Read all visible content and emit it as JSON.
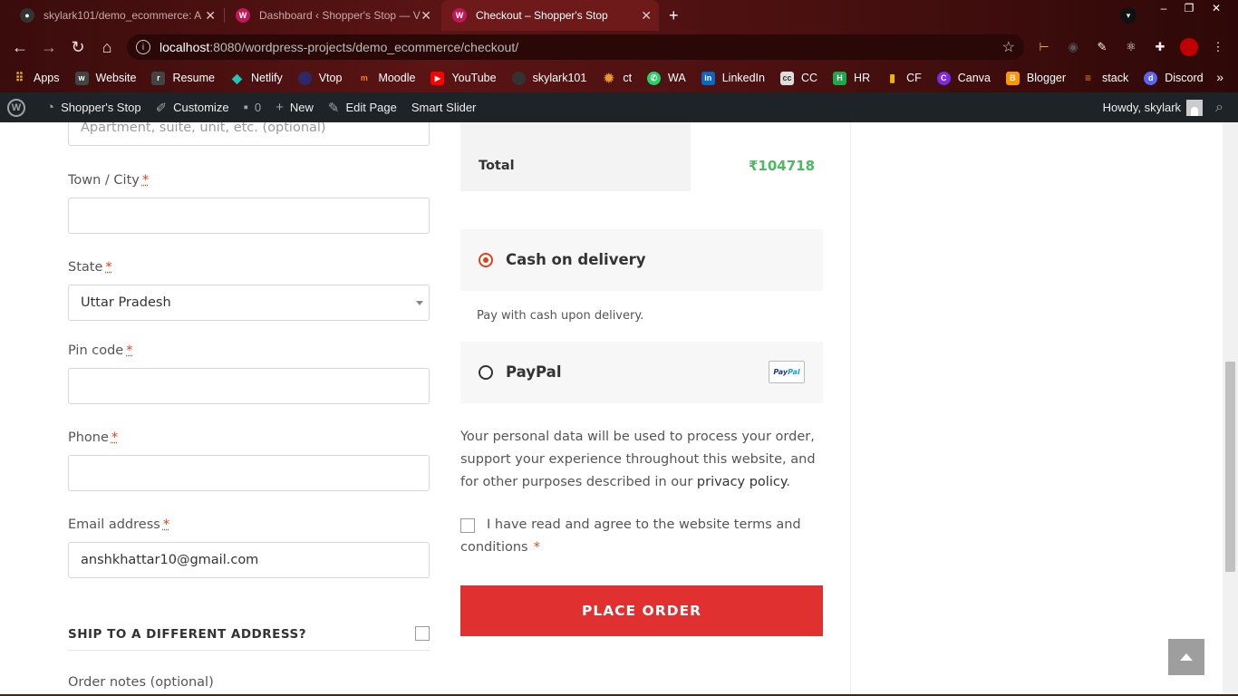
{
  "browser": {
    "tabs": [
      {
        "title": "skylark101/demo_ecommerce: A",
        "icon": "github-icon"
      },
      {
        "title": "Dashboard ‹ Shopper's Stop — V",
        "icon": "wordpress-icon"
      },
      {
        "title": "Checkout – Shopper's Stop",
        "icon": "wordpress-icon",
        "active": true
      }
    ],
    "new_tab": "+",
    "window_controls": {
      "minimize": "–",
      "restore": "❐",
      "close": "✕"
    },
    "url_host": "localhost",
    "url_path": ":8080/wordpress-projects/demo_ecommerce/checkout/",
    "bookmarks": [
      {
        "label": "Apps",
        "icon": "apps-grid-icon",
        "color": "#f4b400"
      },
      {
        "label": "Website",
        "icon": "website-icon",
        "color": "#444444"
      },
      {
        "label": "Resume",
        "icon": "resume-icon",
        "color": "#444444"
      },
      {
        "label": "Netlify",
        "icon": "netlify-icon",
        "color": "#20c6b7"
      },
      {
        "label": "Vtop",
        "icon": "vtop-icon",
        "color": "#2a2a6a"
      },
      {
        "label": "Moodle",
        "icon": "moodle-icon",
        "color": "#f98012"
      },
      {
        "label": "YouTube",
        "icon": "youtube-icon",
        "color": "#ff0000"
      },
      {
        "label": "skylark101",
        "icon": "github-icon",
        "color": "#333333"
      },
      {
        "label": "ct",
        "icon": "ct-icon",
        "color": "#e89a2c"
      },
      {
        "label": "WA",
        "icon": "whatsapp-icon",
        "color": "#25d366"
      },
      {
        "label": "LinkedIn",
        "icon": "linkedin-icon",
        "color": "#0a66c2"
      },
      {
        "label": "CC",
        "icon": "codechef-icon",
        "color": "#5b4638"
      },
      {
        "label": "HR",
        "icon": "hackerrank-icon",
        "color": "#1ba94c"
      },
      {
        "label": "CF",
        "icon": "codeforces-icon",
        "color": "#1f8acb"
      },
      {
        "label": "Canva",
        "icon": "canva-icon",
        "color": "#7d2ae8"
      },
      {
        "label": "Blogger",
        "icon": "blogger-icon",
        "color": "#ff5722"
      },
      {
        "label": "stack",
        "icon": "stackoverflow-icon",
        "color": "#f48024"
      },
      {
        "label": "Discord",
        "icon": "discord-icon",
        "color": "#5865f2"
      }
    ],
    "bookmarks_more": "»"
  },
  "wp_admin_bar": {
    "site": "Shopper's Stop",
    "customize": "Customize",
    "comments_count": "0",
    "new": "New",
    "edit_page": "Edit Page",
    "smart_slider": "Smart Slider",
    "howdy": "Howdy, skylark"
  },
  "billing": {
    "apartment_placeholder": "Apartment, suite, unit, etc. (optional)",
    "town_label": "Town / City",
    "state_label": "State",
    "state_value": "Uttar Pradesh",
    "pin_label": "Pin code",
    "phone_label": "Phone",
    "email_label": "Email address",
    "email_value": "anshkhattar10@gmail.com",
    "required_mark": "*",
    "ship_different": "SHIP TO A DIFFERENT ADDRESS?",
    "order_notes_label": "Order notes (optional)"
  },
  "order": {
    "total_label": "Total",
    "total_value": "₹104718"
  },
  "payment": {
    "cod_label": "Cash on delivery",
    "cod_description": "Pay with cash upon delivery.",
    "paypal_label": "PayPal",
    "selected": "cod"
  },
  "privacy_text": "Your personal data will be used to process your order, support your experience throughout this website, and for other purposes described in our",
  "privacy_link": "privacy policy",
  "terms_text": "I have read and agree to the website terms and conditions",
  "terms_required": "*",
  "place_order_label": "PLACE ORDER",
  "colors": {
    "accent_red": "#e03030",
    "total_green": "#4cb963",
    "required_red": "#e2401c"
  }
}
